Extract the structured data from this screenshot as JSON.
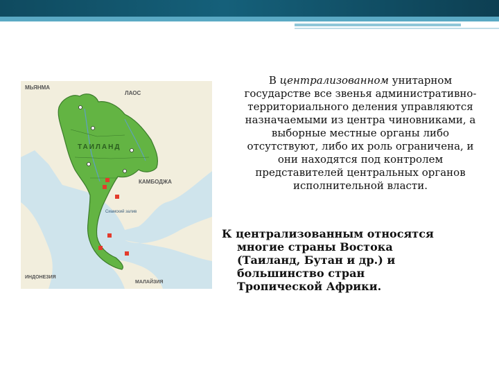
{
  "slide": {
    "paragraph1": {
      "prefix": "В",
      "emphasis": "централизованном",
      "rest": "унитарном государстве все звенья административно-территориального деления управляются назначаемыми из центра чиновниками, а выборные местные органы либо отсутствуют, либо их роль ограничена, и они находятся под контролем представителей центральных органов исполнительной власти."
    },
    "paragraph2": {
      "lines": [
        "К централизованным относятся",
        "многие страны Востока",
        "(Таиланд, Бутан и др.) и",
        "большинство стран",
        "Тропической Африки."
      ]
    }
  },
  "map": {
    "labels": {
      "myanma": "МЬЯНМА",
      "laos": "ЛАОС",
      "thailand": "ТАИЛАНД",
      "cambodia": "КАМБОДЖА",
      "indonesia": "ИНДОНЕЗИЯ",
      "malaysia": "МАЛАЙЗИЯ",
      "gulf": "Сиамский залив"
    },
    "colors": {
      "land_thailand": "#63b443",
      "land_other": "#f2eedd",
      "sea": "#cfe4ec",
      "border": "#3a7a2a",
      "river": "#5e9fc7",
      "city": "#e33b2c"
    }
  }
}
